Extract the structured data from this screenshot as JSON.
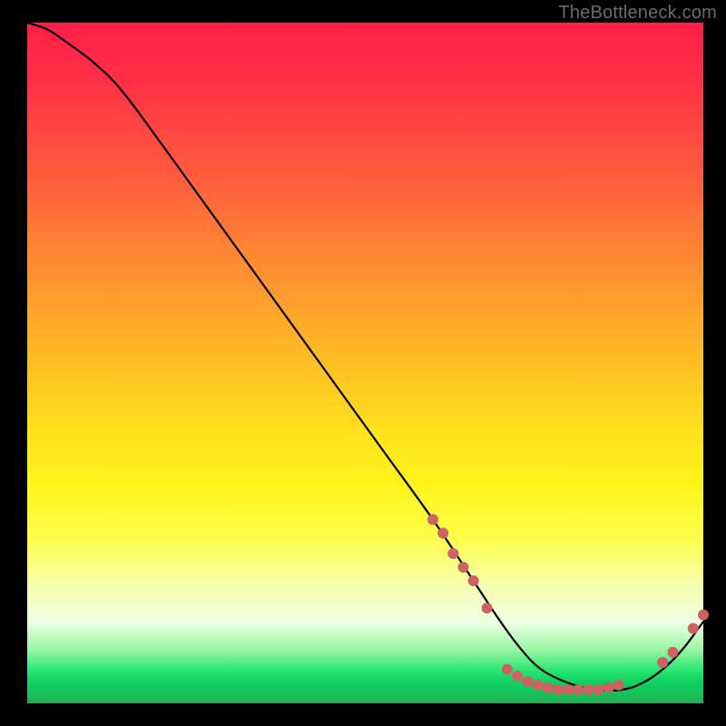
{
  "watermark": "TheBottleneck.com",
  "chart_data": {
    "type": "line",
    "title": "",
    "xlabel": "",
    "ylabel": "",
    "xlim": [
      0,
      100
    ],
    "ylim": [
      0,
      100
    ],
    "background_gradient": {
      "top_color": "#ff1f49",
      "mid_colors": [
        "#ff8a33",
        "#ffe11c",
        "#f6ffb1"
      ],
      "bottom_color": "#24ad52"
    },
    "series": [
      {
        "name": "bottleneck-curve",
        "color": "#000000",
        "x": [
          0,
          3,
          6,
          10,
          14,
          20,
          28,
          36,
          44,
          52,
          60,
          66,
          70,
          73,
          76,
          80,
          84,
          88,
          91,
          94,
          97,
          100
        ],
        "y": [
          100,
          99,
          97,
          94,
          90,
          82,
          71,
          60,
          49,
          38,
          27,
          18,
          12,
          8,
          5,
          3,
          2,
          2,
          3,
          5,
          8,
          12
        ]
      }
    ],
    "markers": {
      "name": "highlight-points",
      "color": "#cc6261",
      "points": [
        {
          "x": 60.0,
          "y": 27
        },
        {
          "x": 61.5,
          "y": 25
        },
        {
          "x": 63.0,
          "y": 22
        },
        {
          "x": 64.5,
          "y": 20
        },
        {
          "x": 66.0,
          "y": 18
        },
        {
          "x": 68.0,
          "y": 14
        },
        {
          "x": 71.0,
          "y": 5.0
        },
        {
          "x": 72.5,
          "y": 4.0
        },
        {
          "x": 74.0,
          "y": 3.2
        },
        {
          "x": 75.5,
          "y": 2.7
        },
        {
          "x": 77.0,
          "y": 2.3
        },
        {
          "x": 78.5,
          "y": 2.0
        },
        {
          "x": 80.0,
          "y": 2.0
        },
        {
          "x": 81.5,
          "y": 2.0
        },
        {
          "x": 83.0,
          "y": 2.0
        },
        {
          "x": 84.5,
          "y": 2.0
        },
        {
          "x": 86.0,
          "y": 2.3
        },
        {
          "x": 87.5,
          "y": 2.7
        },
        {
          "x": 94.0,
          "y": 6.0
        },
        {
          "x": 95.5,
          "y": 7.5
        },
        {
          "x": 98.5,
          "y": 11.0
        },
        {
          "x": 100.0,
          "y": 13.0
        }
      ]
    }
  }
}
